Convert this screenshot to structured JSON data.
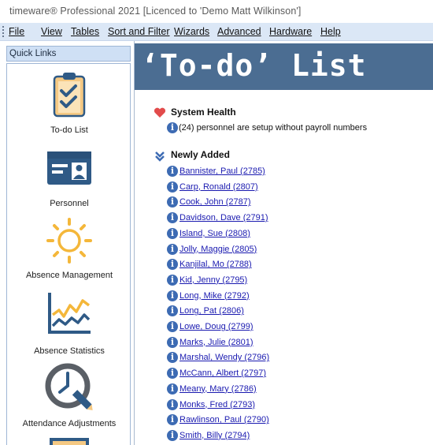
{
  "window": {
    "title": "timeware® Professional 2021 [Licenced to 'Demo Matt Wilkinson']"
  },
  "menu": [
    "File",
    "View",
    "Tables",
    "Sort and Filter",
    "Wizards",
    "Advanced",
    "Hardware",
    "Help"
  ],
  "quick_links": {
    "header": "Quick Links",
    "items": [
      "To-do List",
      "Personnel",
      "Absence Management",
      "Absence Statistics",
      "Attendance Adjustments"
    ]
  },
  "main": {
    "banner": "‘To-do’ List",
    "system_health": {
      "title": "System Health",
      "message": "(24) personnel are setup without payroll numbers"
    },
    "newly_added": {
      "title": "Newly Added",
      "people": [
        "Bannister, Paul (2785)",
        "Carp, Ronald (2807)",
        "Cook, John (2787)",
        "Davidson, Dave (2791)",
        "Island, Sue (2808)",
        "Jolly, Maggie (2805)",
        "Kanjilal, Mo (2788)",
        "Kid, Jenny (2795)",
        "Long, Mike (2792)",
        "Long, Pat (2806)",
        "Lowe, Doug (2799)",
        "Marks, Julie (2801)",
        "Marshal, Wendy (2796)",
        "McCann, Albert (2797)",
        "Meany, Mary (2786)",
        "Monks, Fred (2793)",
        "Rawlinson, Paul (2790)",
        "Smith, Billy (2794)"
      ]
    }
  },
  "colors": {
    "banner": "#4b6d92",
    "menubar": "#dbe7f6",
    "link": "#1a1ab0",
    "info_icon": "#3d6bb3",
    "heart": "#e24b4b"
  }
}
